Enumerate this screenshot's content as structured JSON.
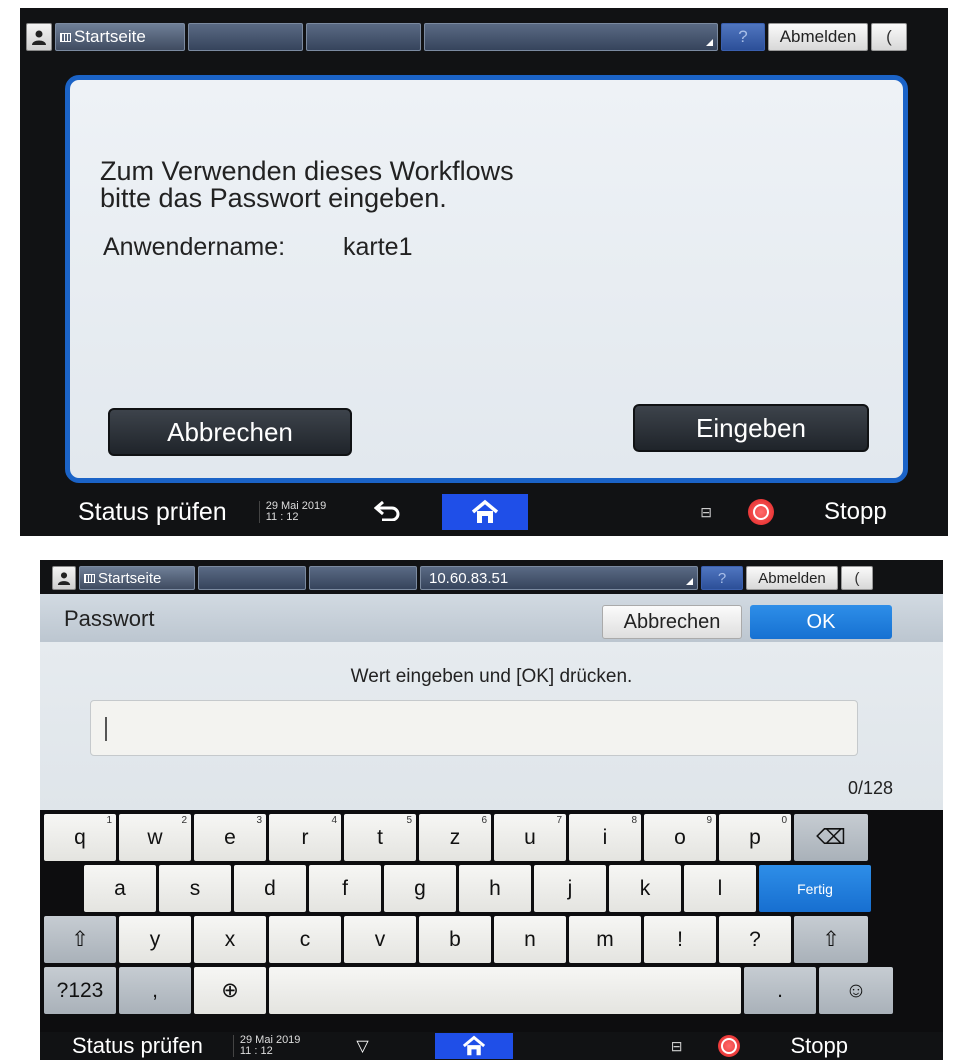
{
  "screen1": {
    "topbar": {
      "home_label": "Startseite",
      "help": "?",
      "logout": "Abmelden",
      "moon": "("
    },
    "dialog": {
      "message_line1": "Zum Verwenden dieses Workflows",
      "message_line2": "bitte das Passwort eingeben.",
      "username_label": "Anwendername:",
      "username_value": "karte1",
      "cancel_label": "Abbrechen",
      "enter_label": "Eingeben"
    },
    "bottombar": {
      "status": "Status prüfen",
      "date": "29 Mai 2019",
      "time": "11 : 12",
      "stop": "Stopp"
    }
  },
  "screen2": {
    "topbar": {
      "home_label": "Startseite",
      "address": "10.60.83.51",
      "help": "?",
      "logout": "Abmelden",
      "moon": "("
    },
    "header": {
      "title": "Passwort",
      "cancel_label": "Abbrechen",
      "ok_label": "OK"
    },
    "body": {
      "instruction": "Wert eingeben und [OK] drücken.",
      "input_value": "",
      "counter": "0/128"
    },
    "keyboard": {
      "row1": [
        {
          "k": "q",
          "n": "1"
        },
        {
          "k": "w",
          "n": "2"
        },
        {
          "k": "e",
          "n": "3"
        },
        {
          "k": "r",
          "n": "4"
        },
        {
          "k": "t",
          "n": "5"
        },
        {
          "k": "z",
          "n": "6"
        },
        {
          "k": "u",
          "n": "7"
        },
        {
          "k": "i",
          "n": "8"
        },
        {
          "k": "o",
          "n": "9"
        },
        {
          "k": "p",
          "n": "0"
        }
      ],
      "backspace": "⌫",
      "row2": [
        "a",
        "s",
        "d",
        "f",
        "g",
        "h",
        "j",
        "k",
        "l"
      ],
      "done": "Fertig",
      "row3": [
        "y",
        "x",
        "c",
        "v",
        "b",
        "n",
        "m",
        "!",
        "?"
      ],
      "shift": "⇧",
      "mode": "?123",
      "comma": ",",
      "period": ".",
      "globe": "⊕",
      "emoji": "☺"
    },
    "bottombar": {
      "status": "Status prüfen",
      "date": "29 Mai 2019",
      "time": "11 : 12",
      "stop": "Stopp"
    }
  }
}
